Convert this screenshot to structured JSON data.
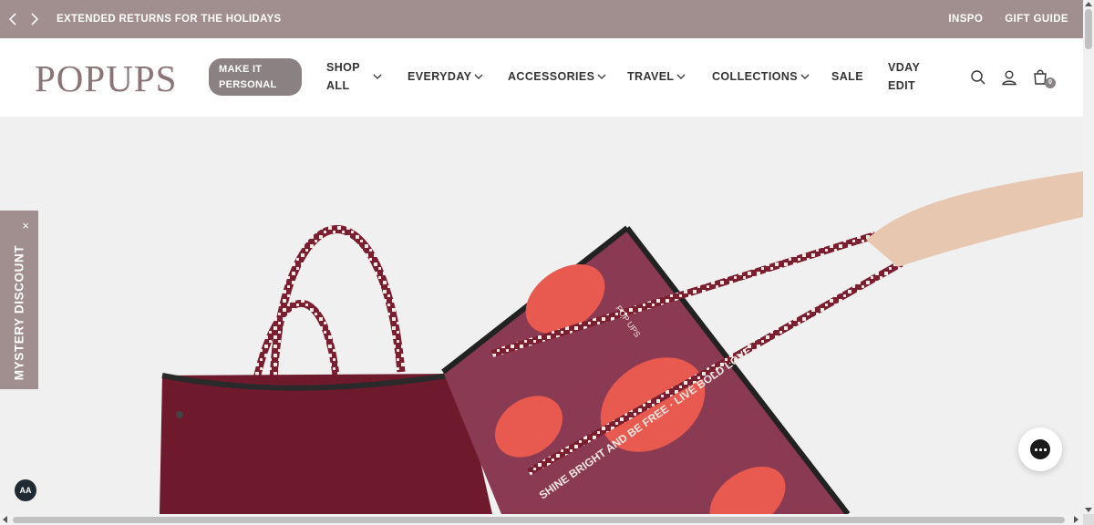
{
  "announcement": {
    "message": "EXTENDED RETURNS FOR THE HOLIDAYS",
    "links": [
      "INSPO",
      "GIFT GUIDE"
    ],
    "background": "#a18e8f"
  },
  "header": {
    "logo": "POPUPS",
    "personal_button": {
      "line1": "MAKE IT",
      "line2": "PERSONAL"
    },
    "nav": {
      "shop_all": {
        "line1": "SHOP",
        "line2": "ALL"
      },
      "everyday": "EVERYDAY",
      "accessories": "ACCESSORIES",
      "travel": "TRAVEL",
      "collections": "COLLECTIONS",
      "sale": "SALE",
      "vday": {
        "line1": "VDAY",
        "line2": "EDIT"
      }
    },
    "cart_count": "0"
  },
  "hero": {
    "bag_text": "SHINE BRIGHT AND BE FREE · LIVE BOLD LOVE",
    "bag_brand": "POP UPS"
  },
  "mystery_tab": {
    "label": "MYSTERY DISCOUNT",
    "close": "×"
  },
  "a11y_label": "AA",
  "colors": {
    "accent": "#a18e8f",
    "button": "#8a8282",
    "maroon": "#6e1a2c",
    "print": "#8a3a52"
  }
}
